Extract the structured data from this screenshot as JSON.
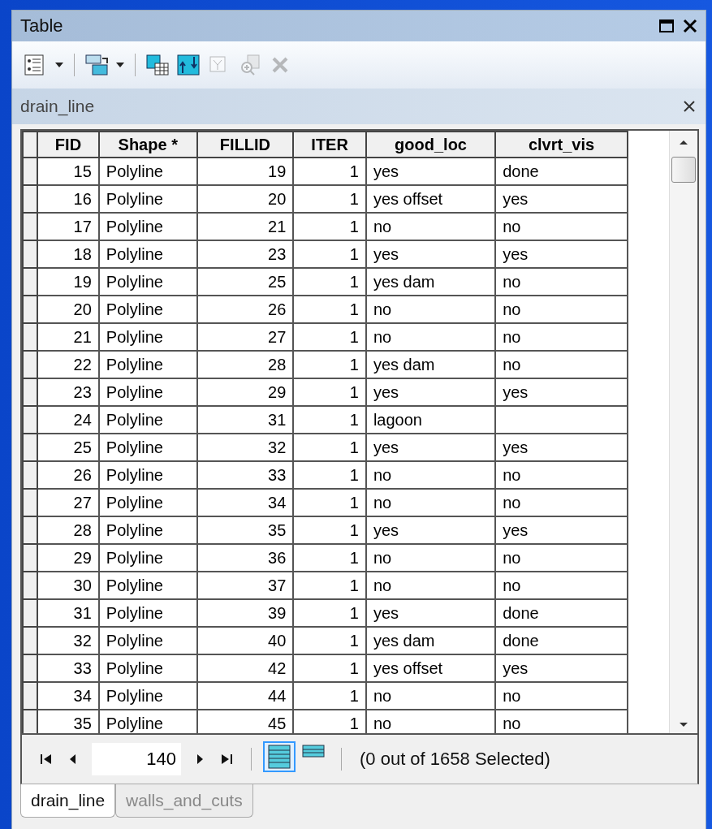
{
  "window": {
    "title": "Table"
  },
  "toolbar": [
    {
      "kind": "options",
      "disabled": false
    },
    {
      "kind": "related",
      "disabled": false
    },
    {
      "kind": "select-by",
      "disabled": false
    },
    {
      "kind": "switch",
      "disabled": false
    },
    {
      "kind": "clear",
      "disabled": true
    },
    {
      "kind": "zoom",
      "disabled": true
    },
    {
      "kind": "delete",
      "disabled": true
    }
  ],
  "table_name": "drain_line",
  "table": {
    "columns": [
      "FID",
      "Shape *",
      "FILLID",
      "ITER",
      "good_loc",
      "clvrt_vis"
    ],
    "rows": [
      [
        "15",
        "Polyline",
        "19",
        "1",
        "yes",
        "done"
      ],
      [
        "16",
        "Polyline",
        "20",
        "1",
        "yes offset",
        "yes"
      ],
      [
        "17",
        "Polyline",
        "21",
        "1",
        "no",
        "no"
      ],
      [
        "18",
        "Polyline",
        "23",
        "1",
        "yes",
        "yes"
      ],
      [
        "19",
        "Polyline",
        "25",
        "1",
        "yes dam",
        "no"
      ],
      [
        "20",
        "Polyline",
        "26",
        "1",
        "no",
        "no"
      ],
      [
        "21",
        "Polyline",
        "27",
        "1",
        "no",
        "no"
      ],
      [
        "22",
        "Polyline",
        "28",
        "1",
        "yes dam",
        "no"
      ],
      [
        "23",
        "Polyline",
        "29",
        "1",
        "yes",
        "yes"
      ],
      [
        "24",
        "Polyline",
        "31",
        "1",
        "lagoon",
        ""
      ],
      [
        "25",
        "Polyline",
        "32",
        "1",
        "yes",
        "yes"
      ],
      [
        "26",
        "Polyline",
        "33",
        "1",
        "no",
        "no"
      ],
      [
        "27",
        "Polyline",
        "34",
        "1",
        "no",
        "no"
      ],
      [
        "28",
        "Polyline",
        "35",
        "1",
        "yes",
        "yes"
      ],
      [
        "29",
        "Polyline",
        "36",
        "1",
        "no",
        "no"
      ],
      [
        "30",
        "Polyline",
        "37",
        "1",
        "no",
        "no"
      ],
      [
        "31",
        "Polyline",
        "39",
        "1",
        "yes",
        "done"
      ],
      [
        "32",
        "Polyline",
        "40",
        "1",
        "yes dam",
        "done"
      ],
      [
        "33",
        "Polyline",
        "42",
        "1",
        "yes offset",
        "yes"
      ],
      [
        "34",
        "Polyline",
        "44",
        "1",
        "no",
        "no"
      ],
      [
        "35",
        "Polyline",
        "45",
        "1",
        "no",
        "no"
      ]
    ]
  },
  "footer": {
    "record": "140",
    "views": [
      {
        "kind": "all",
        "selected": true
      },
      {
        "kind": "selected",
        "selected": false
      }
    ],
    "status": "(0 out of 1658 Selected)"
  },
  "tabs": [
    {
      "label": "drain_line",
      "selected": true
    },
    {
      "label": "walls_and_cuts",
      "selected": false
    }
  ]
}
